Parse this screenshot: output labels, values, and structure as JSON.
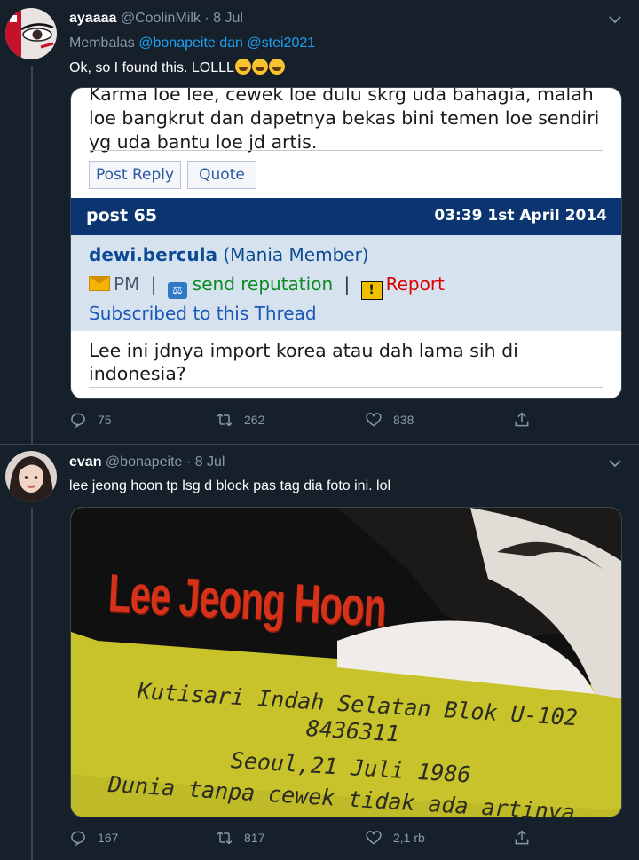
{
  "tweet1": {
    "name": "ayaaaa",
    "handle": "@CoolinMilk",
    "dot": "·",
    "date": "8 Jul",
    "reply_prefix": "Membalas",
    "reply_to_1": "@bonapeite",
    "reply_and": "dan",
    "reply_to_2": "@stei2021",
    "text": "Ok, so I found this. LOLLL",
    "forum": {
      "top_text": "Karma loe lee, cewek loe dulu skrg uda bahagia, malah loe bangkrut dan dapetnya bekas bini temen loe sendiri yg uda bantu loe jd artis.",
      "post_reply_label": "Post Reply",
      "quote_label": "Quote",
      "post_number": "post 65",
      "post_datetime": "03:39 1st April 2014",
      "username": "dewi.bercula",
      "user_title": "(Mania Member)",
      "pm_label": "PM",
      "separator": "|",
      "reputation_label": "send reputation",
      "report_label": "Report",
      "subscribed_label": "Subscribed to this Thread",
      "body": "Lee ini jdnya import korea atau dah lama sih di indonesia?"
    },
    "actions": {
      "replies": "75",
      "retweets": "262",
      "likes": "838"
    }
  },
  "tweet2": {
    "name": "evan",
    "handle": "@bonapeite",
    "dot": "·",
    "date": "8 Jul",
    "text": "lee jeong hoon tp lsg d block pas tag dia foto ini. lol",
    "card": {
      "name": "Lee Jeong Hoon",
      "line1": "Kutisari Indah Selatan Blok U-102",
      "line2": "8436311",
      "line3": "Seoul,21 Juli 1986",
      "line4": "Dunia tanpa cewek tidak ada artinya"
    },
    "actions": {
      "replies": "167",
      "retweets": "817",
      "likes": "2,1 rb"
    }
  },
  "colors": {
    "background": "#15202b",
    "accent": "#1da1f2",
    "muted": "#8899a6",
    "forum_header": "#0a3570"
  }
}
